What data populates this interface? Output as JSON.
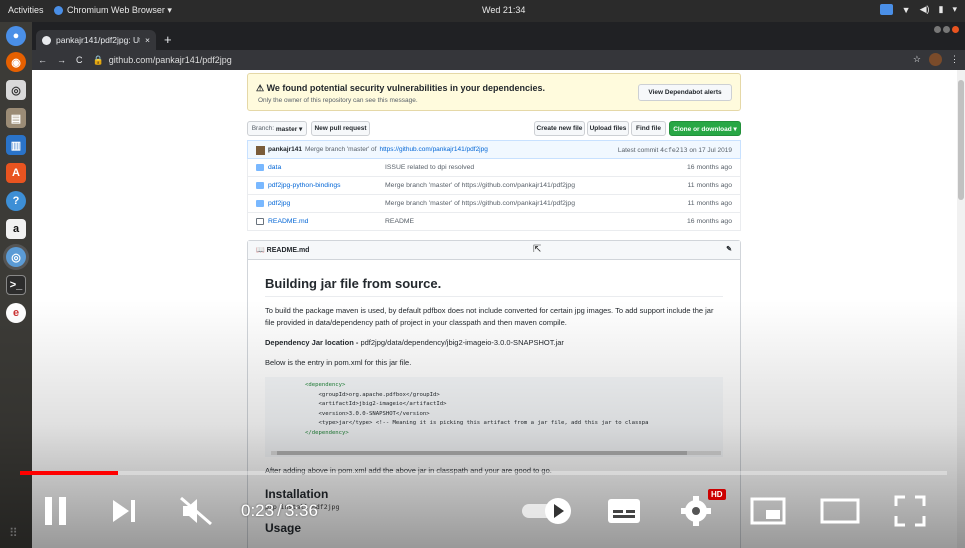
{
  "system": {
    "activities": "Activities",
    "app_name": "Chromium Web Browser ▾",
    "clock": "Wed 21:34"
  },
  "dock": {
    "items": [
      "chrome-icon",
      "firefox-icon",
      "disk-icon",
      "files-icon",
      "writer-icon",
      "software-icon",
      "help-icon",
      "amazon-icon",
      "chromium-icon",
      "terminal-icon",
      "app-icon"
    ]
  },
  "browser": {
    "tab_title": "pankajr141/pdf2jpg: Util...",
    "tab_close": "×",
    "new_tab": "+",
    "url": "github.com/pankajr141/pdf2jpg"
  },
  "alert": {
    "message": "We found potential security vulnerabilities in your dependencies.",
    "sub": "Only the owner of this repository can see this message.",
    "button": "View Dependabot alerts"
  },
  "repo_toolbar": {
    "branch_label": "Branch:",
    "branch": "master ▾",
    "new_pr": "New pull request",
    "create_file": "Create new file",
    "upload_files": "Upload files",
    "find_file": "Find file",
    "clone": "Clone or download ▾"
  },
  "commit": {
    "author": "pankajr141",
    "message": "Merge branch 'master' of",
    "link": "https://github.com/pankajr141/pdf2jpg",
    "latest": "Latest commit",
    "sha": "4cfe213",
    "date": "on 17 Jul 2019"
  },
  "files": [
    {
      "name": "data",
      "type": "dir",
      "message": "ISSUE related to dpi resolved",
      "age": "16 months ago"
    },
    {
      "name": "pdf2jpg-python-bindings",
      "type": "dir",
      "message": "Merge branch 'master' of https://github.com/pankajr141/pdf2jpg",
      "age": "11 months ago"
    },
    {
      "name": "pdf2jpg",
      "type": "dir",
      "message": "Merge branch 'master' of https://github.com/pankajr141/pdf2jpg",
      "age": "11 months ago"
    },
    {
      "name": "README.md",
      "type": "file",
      "message": "README",
      "age": "16 months ago"
    }
  ],
  "readme": {
    "header": "README.md",
    "h_build": "Building jar file from source.",
    "p1": "To build the package maven is used, by default pdfbox does not include converted for certain jpg images. To add support include the jar file provided in data/dependency path of project in your classpath and then maven compile.",
    "dep_label": "Dependency Jar location - ",
    "dep_path": "pdf2jpg/data/dependency/jbig2-imageio-3.0.0-SNAPSHOT.jar",
    "p2": "Below is the entry in pom.xml for this jar file.",
    "code_lines": [
      "<dependency>",
      "    <groupId>org.apache.pdfbox</groupId>",
      "    <artifactId>jbig2-imageio</artifactId>",
      "    <version>3.0.0-SNAPSHOT</version>",
      "    <type>jar</type> <!-- Meaning it is picking this artifact from a jar file, add this jar to classpa",
      "</dependency>"
    ],
    "p3": "After adding above in pom.xml add the above jar in classpath and your are good to go.",
    "h_install": "Installation",
    "pip": "pip install pdf2jpg",
    "h_usage": "Usage"
  },
  "player": {
    "current_time": "0:23",
    "separator": "/",
    "duration": "3:36",
    "played_fraction": 0.106,
    "hd_badge": "HD"
  }
}
